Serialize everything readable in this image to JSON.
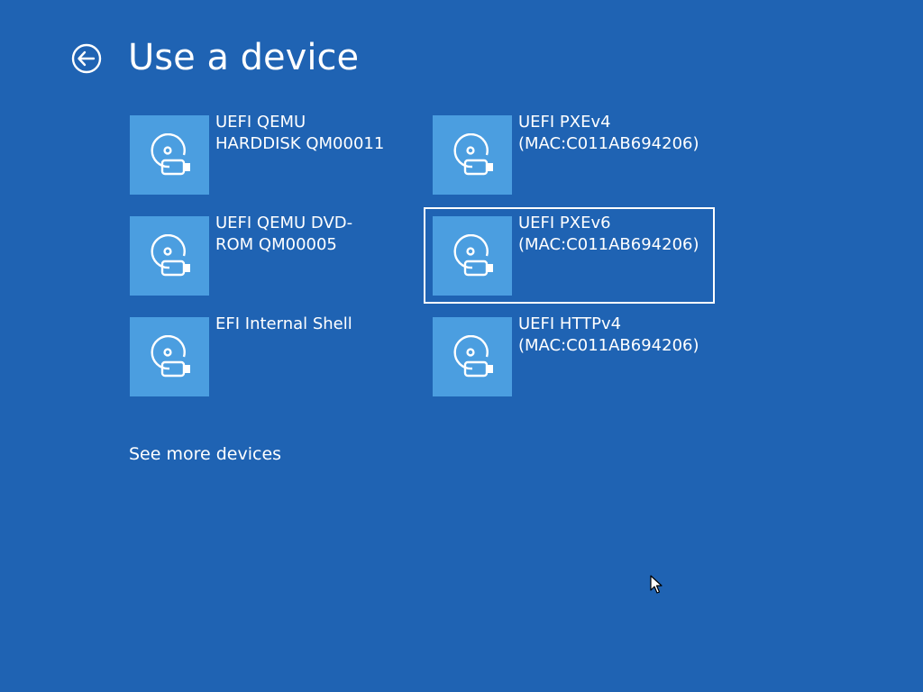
{
  "header": {
    "title": "Use a device",
    "back_icon": "back-arrow-circle-icon"
  },
  "devices": [
    {
      "label": "UEFI QEMU\nHARDDISK QM00011",
      "icon": "disc-drive-icon",
      "selected": false
    },
    {
      "label": "UEFI PXEv4\n(MAC:C011AB694206)",
      "icon": "disc-drive-icon",
      "selected": false
    },
    {
      "label": "UEFI QEMU DVD-\nROM QM00005",
      "icon": "disc-drive-icon",
      "selected": false
    },
    {
      "label": "UEFI PXEv6\n(MAC:C011AB694206)",
      "icon": "disc-drive-icon",
      "selected": true
    },
    {
      "label": "EFI Internal Shell",
      "icon": "disc-drive-icon",
      "selected": false
    },
    {
      "label": "UEFI HTTPv4\n(MAC:C011AB694206)",
      "icon": "disc-drive-icon",
      "selected": false
    }
  ],
  "footer": {
    "see_more_label": "See more devices"
  },
  "colors": {
    "background": "#1f63b3",
    "tile_icon_bg": "#4b9ee0",
    "text": "#ffffff"
  }
}
